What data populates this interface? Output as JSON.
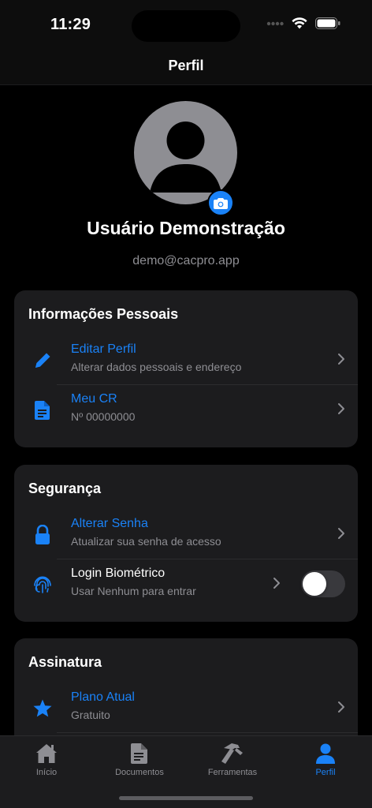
{
  "status_bar": {
    "time": "11:29"
  },
  "nav": {
    "title": "Perfil"
  },
  "profile": {
    "name": "Usuário Demonstração",
    "email": "demo@cacpro.app"
  },
  "sections": {
    "personal": {
      "title": "Informações Pessoais",
      "rows": [
        {
          "title": "Editar Perfil",
          "subtitle": "Alterar dados pessoais e endereço",
          "icon": "pencil-icon"
        },
        {
          "title": "Meu CR",
          "subtitle": "Nº 00000000",
          "icon": "document-icon"
        }
      ]
    },
    "security": {
      "title": "Segurança",
      "rows": [
        {
          "title": "Alterar Senha",
          "subtitle": "Atualizar sua senha de acesso",
          "icon": "lock-icon"
        },
        {
          "title": "Login Biométrico",
          "subtitle": "Usar Nenhum para entrar",
          "icon": "fingerprint-icon",
          "toggle": false
        }
      ]
    },
    "subscription": {
      "title": "Assinatura",
      "rows": [
        {
          "title": "Plano Atual",
          "subtitle": "Gratuito",
          "icon": "star-icon"
        }
      ]
    }
  },
  "tabs": [
    {
      "label": "Início",
      "icon": "house-icon",
      "active": false
    },
    {
      "label": "Documentos",
      "icon": "doc-icon",
      "active": false
    },
    {
      "label": "Ferramentas",
      "icon": "hammer-icon",
      "active": false
    },
    {
      "label": "Perfil",
      "icon": "person-icon",
      "active": true
    }
  ],
  "colors": {
    "accent": "#1a82f7",
    "card": "#1c1c1e",
    "secondary_text": "#8e8e93",
    "background": "#000000"
  }
}
